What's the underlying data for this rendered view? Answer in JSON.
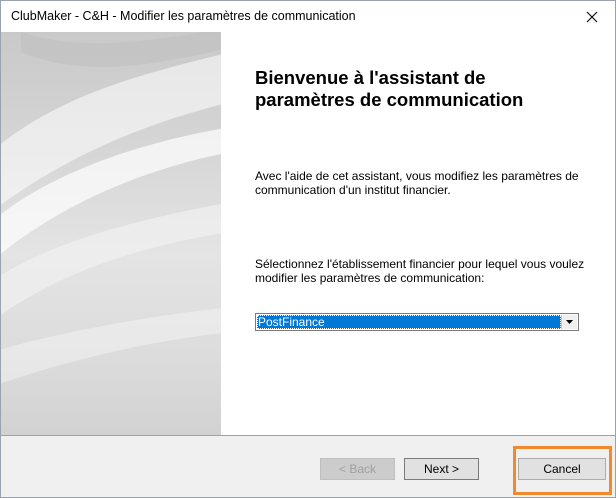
{
  "window": {
    "title": "ClubMaker - C&H - Modifier les paramètres de communication"
  },
  "wizard": {
    "heading": "Bienvenue à l'assistant de paramètres de communication",
    "description": "Avec l'aide de cet assistant, vous modifiez les paramètres de communication d'un institut financier.",
    "select_label": "Sélectionnez l'établissement financier pour lequel vous voulez modifier les paramètres de communication:",
    "institution": {
      "selected": "PostFinance"
    }
  },
  "buttons": {
    "back_label": "< Back",
    "next_label": "Next >",
    "cancel_label": "Cancel"
  },
  "colors": {
    "selection": "#0078d7",
    "highlight": "#f28a2d"
  },
  "icons": {
    "close": "close-icon",
    "dropdown": "chevron-down-icon"
  }
}
